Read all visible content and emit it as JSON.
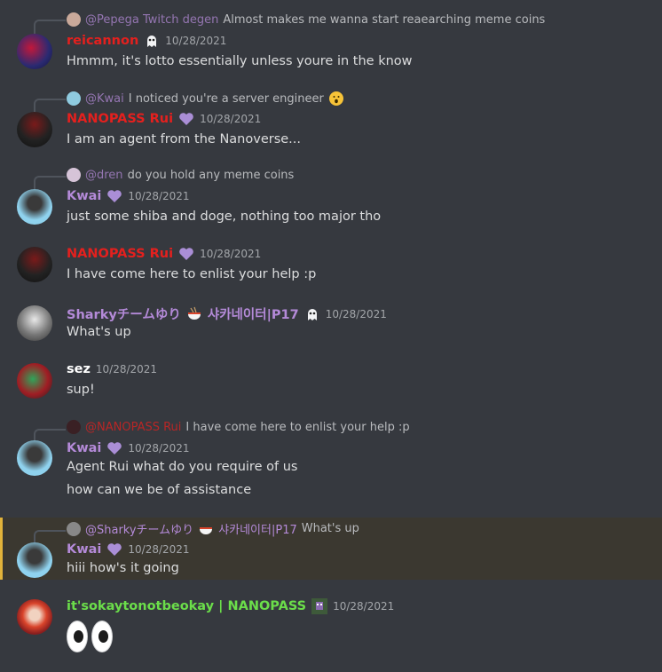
{
  "colors": {
    "background": "#36393f",
    "highlight": "#3b3830",
    "highlight_border": "#e2b33a",
    "red_role": "#e4201e",
    "purple_role": "#b48ad8",
    "green_role": "#6bde4a",
    "white_role": "#ffffff"
  },
  "messages": [
    {
      "reply": {
        "name": "@Pepega Twitch degen",
        "text": "Almost makes me wanna start reaearching meme coins"
      },
      "author": "reicannon",
      "badge": "ghost-icon",
      "time": "10/28/2021",
      "lines": [
        "Hmmm, it's lotto essentially unless youre in the know"
      ]
    },
    {
      "reply": {
        "name": "@Kwai",
        "text": "I noticed you're a server engineer",
        "emoji": "hushed-face-icon"
      },
      "author": "NANOPASS Rui",
      "badge": "purple-heart-icon",
      "time": "10/28/2021",
      "lines": [
        "I am an agent from the Nanoverse..."
      ]
    },
    {
      "reply": {
        "name": "@dren",
        "text": "do you hold any meme coins"
      },
      "author": "Kwai",
      "badge": "purple-heart-icon",
      "time": "10/28/2021",
      "lines": [
        "just some shiba and doge, nothing too major tho"
      ]
    },
    {
      "author": "NANOPASS Rui",
      "badge": "purple-heart-icon",
      "time": "10/28/2021",
      "lines": [
        "I have come here to enlist your help :p"
      ]
    },
    {
      "author": "Sharkyチームゆり",
      "author_suffix": "샤카네이터|P17",
      "badge": "ghost-icon",
      "time": "10/28/2021",
      "lines": [
        "What's up"
      ]
    },
    {
      "author": "sez",
      "time": "10/28/2021",
      "lines": [
        "sup!"
      ]
    },
    {
      "reply": {
        "name": "@NANOPASS Rui",
        "text": "I have come here to enlist your help :p"
      },
      "author": "Kwai",
      "badge": "purple-heart-icon",
      "time": "10/28/2021",
      "lines": [
        "Agent Rui what do you require of us",
        "how can we be of assistance"
      ]
    },
    {
      "reply": {
        "name": "@Sharkyチームゆり",
        "name_suffix": "샤카네이터|P17",
        "text": "What's up"
      },
      "author": "Kwai",
      "badge": "purple-heart-icon",
      "time": "10/28/2021",
      "lines": [
        "hiii how's it going"
      ]
    },
    {
      "author": "it'sokaytonotbeokay | NANOPASS",
      "badge": "pixel-avatar-icon",
      "time": "10/28/2021",
      "emoji": "eyes-icon"
    }
  ]
}
